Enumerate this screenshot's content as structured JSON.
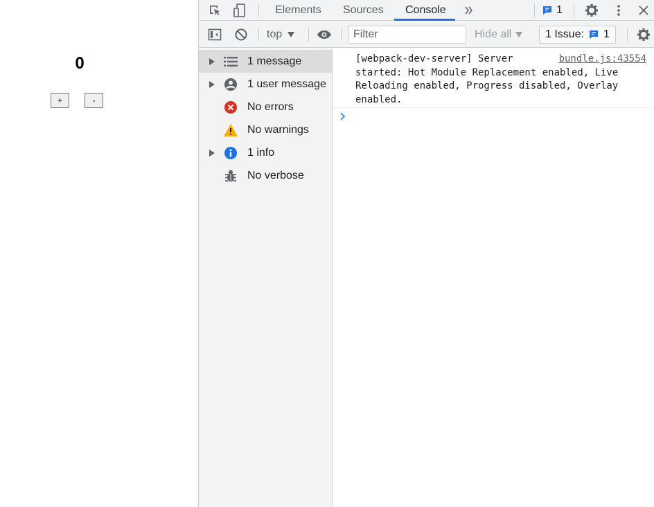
{
  "app": {
    "counter_value": "0",
    "increment_label": "+",
    "decrement_label": "-"
  },
  "devtools": {
    "tabs": [
      {
        "label": "Elements"
      },
      {
        "label": "Sources"
      },
      {
        "label": "Console"
      }
    ],
    "more_tabs_icon": "double-chevron-right",
    "message_badge_count": "1",
    "toolbar": {
      "context_label": "top",
      "filter_placeholder": "Filter",
      "levels_label": "Hide all",
      "issues_label": "1 Issue:",
      "issues_count": "1"
    },
    "sidebar": [
      {
        "label": "1 message",
        "icon": "list-icon",
        "expandable": true
      },
      {
        "label": "1 user message",
        "icon": "user-icon",
        "expandable": true
      },
      {
        "label": "No errors",
        "icon": "error-icon",
        "expandable": false
      },
      {
        "label": "No warnings",
        "icon": "warning-icon",
        "expandable": false
      },
      {
        "label": "1 info",
        "icon": "info-icon",
        "expandable": true
      },
      {
        "label": "No verbose",
        "icon": "bug-icon",
        "expandable": false
      }
    ],
    "console": {
      "message_text": "[webpack-dev-server] Server started: Hot Module Replacement enabled, Live Reloading enabled, Progress disabled, Overlay enabled.",
      "message_source": "bundle.js:43554"
    }
  },
  "colors": {
    "accent": "#1a73e8",
    "error": "#d93025",
    "warning": "#f9ab00",
    "info": "#1a73e8",
    "icon_gray": "#5f6368"
  }
}
